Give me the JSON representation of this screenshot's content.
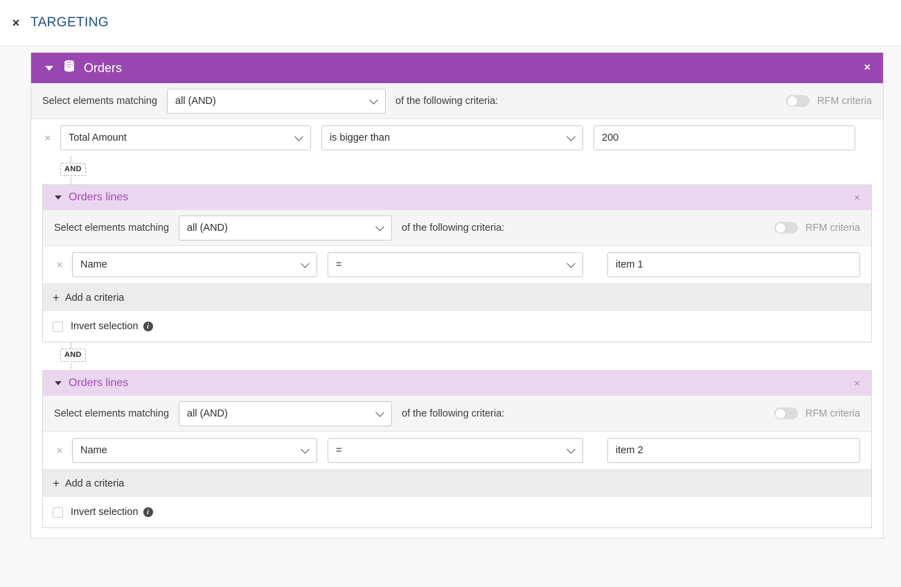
{
  "topbar": {
    "close_label": "×",
    "title": "TARGETING"
  },
  "colors": {
    "brand_purple": "#9847b0",
    "nested_header_bg": "#ead7ef",
    "nested_title": "#a04bb5",
    "title_blue": "#1f4e87",
    "page_bg": "#f8f8f8"
  },
  "card": {
    "header": {
      "title": "Orders",
      "icon": "database-icon",
      "caret": "caret-down-icon",
      "close_label": "×"
    },
    "matching": {
      "prefix_label": "Select elements matching",
      "operator_value": "all (AND)",
      "suffix_label": "of the following criteria:",
      "rfm_label": "RFM criteria",
      "rfm_enabled": false
    },
    "criteria": [
      {
        "remove_label": "×",
        "field": "Total Amount",
        "operator": "is bigger than",
        "value": "200"
      }
    ],
    "connectors": [
      {
        "label": "AND"
      },
      {
        "label": "AND"
      }
    ],
    "nested_cards": [
      {
        "header": {
          "title": "Orders lines",
          "caret": "caret-down-icon",
          "close_label": "×"
        },
        "matching": {
          "prefix_label": "Select elements matching",
          "operator_value": "all (AND)",
          "suffix_label": "of the following criteria:",
          "rfm_label": "RFM criteria",
          "rfm_enabled": false
        },
        "criteria": [
          {
            "remove_label": "×",
            "field": "Name",
            "operator": "=",
            "value": "item 1"
          }
        ],
        "add_criteria_label": "Add a criteria",
        "add_criteria_plus": "+",
        "invert_label": "Invert selection",
        "invert_checked": false,
        "info_glyph": "i"
      },
      {
        "header": {
          "title": "Orders lines",
          "caret": "caret-down-icon",
          "close_label": "×"
        },
        "matching": {
          "prefix_label": "Select elements matching",
          "operator_value": "all (AND)",
          "suffix_label": "of the following criteria:",
          "rfm_label": "RFM criteria",
          "rfm_enabled": false
        },
        "criteria": [
          {
            "remove_label": "×",
            "field": "Name",
            "operator": "=",
            "value": "item 2"
          }
        ],
        "add_criteria_label": "Add a criteria",
        "add_criteria_plus": "+",
        "invert_label": "Invert selection",
        "invert_checked": false,
        "info_glyph": "i"
      }
    ]
  }
}
